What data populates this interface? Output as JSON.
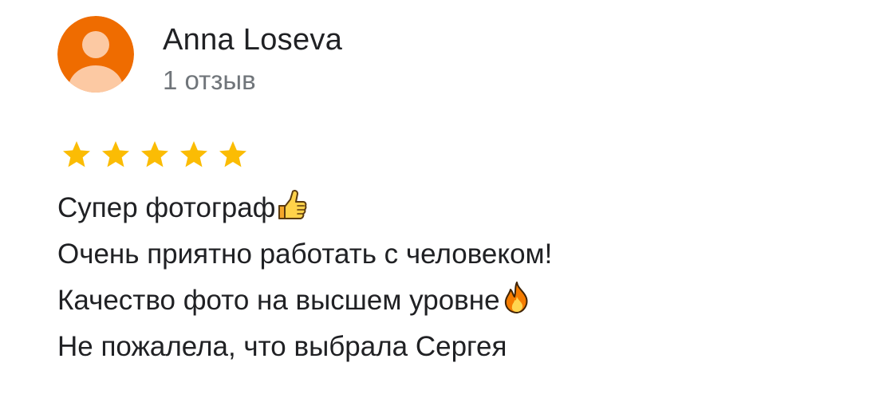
{
  "review": {
    "author": {
      "name": "Anna Loseva",
      "review_count": "1 отзыв",
      "avatar_color": "#ef6c00",
      "avatar_icon": "person-silhouette-icon"
    },
    "rating": {
      "stars": 5,
      "max": 5,
      "star_color": "#fbbc04",
      "star_icon": "star-icon"
    },
    "text": {
      "lines": [
        {
          "text": "Супер фотограф",
          "emoji": "thumbs-up-icon"
        },
        {
          "text": "Очень приятно работать с человеком!",
          "emoji": null
        },
        {
          "text": "Качество фото на высшем уровне",
          "emoji": "fire-icon"
        },
        {
          "text": "Не пожалела, что выбрала Сергея",
          "emoji": null
        }
      ]
    }
  }
}
